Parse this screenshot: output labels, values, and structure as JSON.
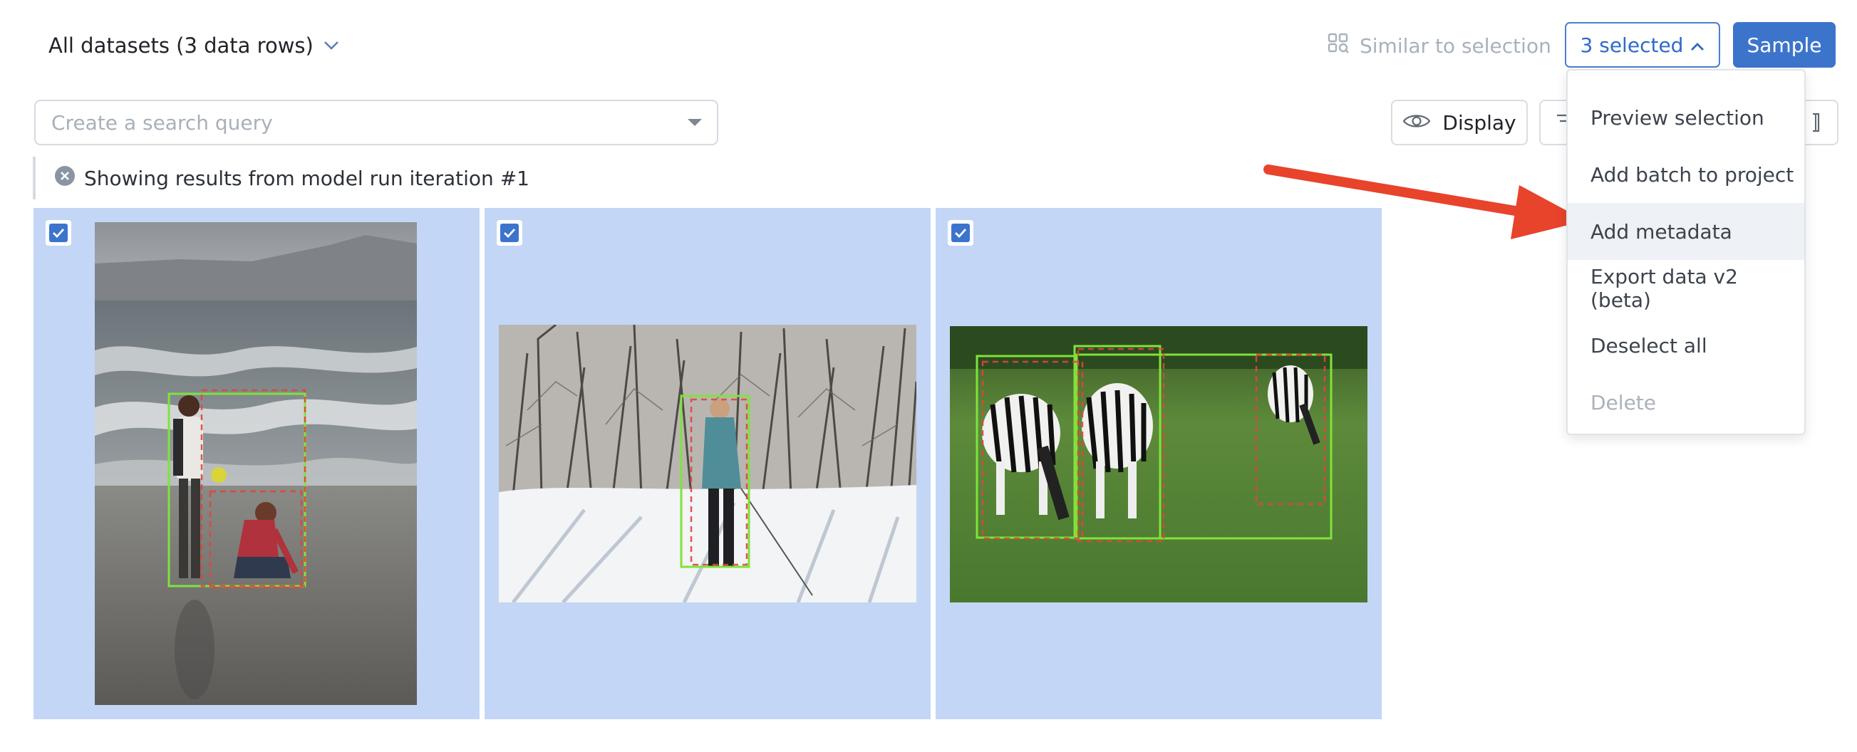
{
  "header": {
    "dataset_label": "All datasets (3 data rows)",
    "similar_label": "Similar to selection",
    "selection_label": "3 selected",
    "sample_label": "Sample"
  },
  "search": {
    "placeholder": "Create a search query"
  },
  "toolbar": {
    "display_label": "Display"
  },
  "notice": {
    "text": "Showing results from model run iteration #1"
  },
  "selection_menu": {
    "items": [
      {
        "label": "Preview selection",
        "state": "enabled"
      },
      {
        "label": "Add batch to project",
        "state": "enabled"
      },
      {
        "label": "Add metadata",
        "state": "hovered"
      },
      {
        "label": "Export data v2 (beta)",
        "state": "enabled"
      },
      {
        "label": "Deselect all",
        "state": "enabled"
      },
      {
        "label": "Delete",
        "state": "disabled"
      }
    ]
  },
  "data_rows": [
    {
      "subject": "beach",
      "selected": true
    },
    {
      "subject": "snow-hiker",
      "selected": true
    },
    {
      "subject": "zebras",
      "selected": true
    }
  ],
  "colors": {
    "accent": "#3c74cc",
    "card_selected_bg": "#c3d6f5",
    "ground_truth_box": "#7fe33b",
    "prediction_box": "#e0453a",
    "annotation_arrow": "#e8432b"
  }
}
